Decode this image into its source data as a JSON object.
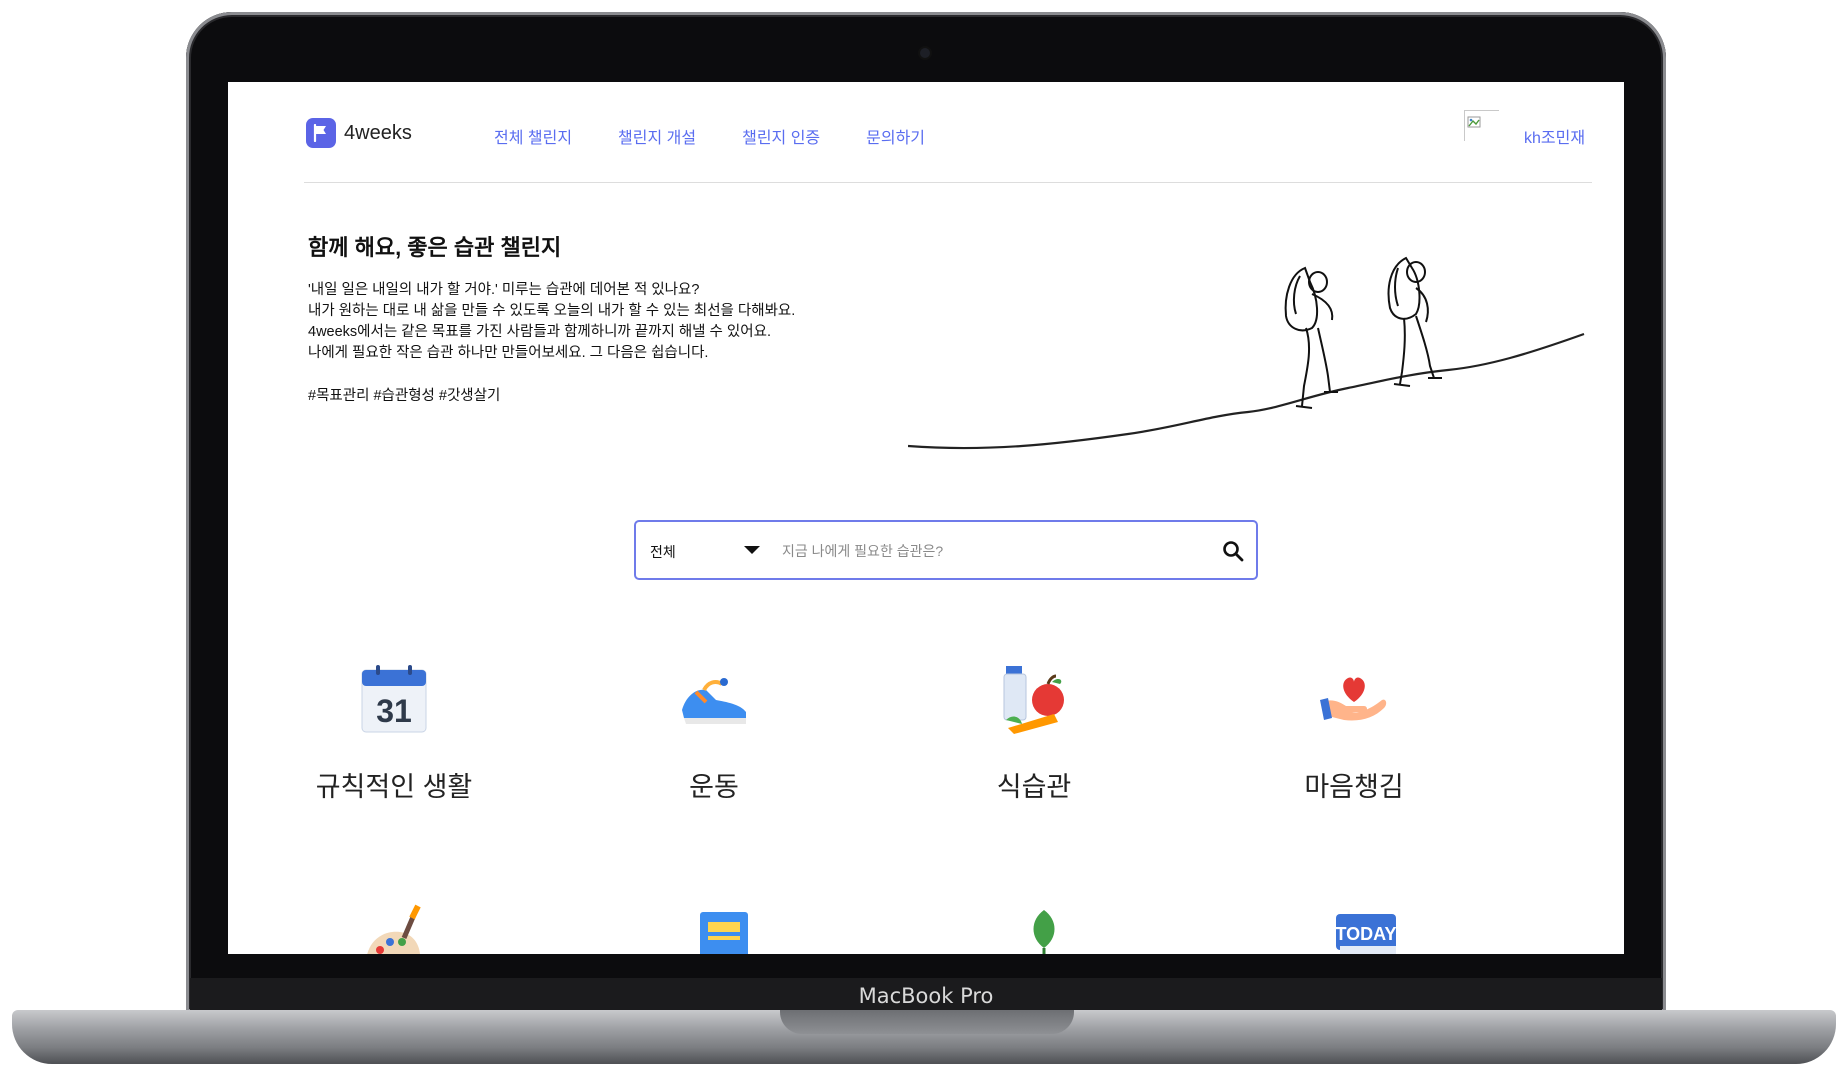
{
  "device": {
    "bezel_label": "MacBook Pro"
  },
  "header": {
    "logo_text": "4weeks",
    "nav": [
      {
        "label": "전체 챌린지"
      },
      {
        "label": "챌린지 개설"
      },
      {
        "label": "챌린지 인증"
      },
      {
        "label": "문의하기"
      }
    ],
    "user_name": "kh조민재"
  },
  "hero": {
    "title": "함께 해요, 좋은 습관 챌린지",
    "lines": [
      "'내일 일은 내일의 내가 할 거야.' 미루는 습관에 데어본 적 있나요?",
      "내가 원하는 대로 내 삶을 만들 수 있도록 오늘의 내가 할 수 있는 최선을 다해봐요.",
      "4weeks에서는 같은 목표를 가진 사람들과 함께하니까 끝까지 해낼 수 있어요.",
      "나에게 필요한 작은 습관 하나만 만들어보세요. 그 다음은 쉽습니다."
    ],
    "tags": "#목표관리 #습관형성 #갓생살기"
  },
  "search": {
    "category": "전체",
    "placeholder": "지금 나에게 필요한 습관은?",
    "value": ""
  },
  "categories": [
    {
      "label": "규칙적인 생활",
      "icon": "calendar-icon",
      "calendar_day": "31"
    },
    {
      "label": "운동",
      "icon": "sneaker-icon"
    },
    {
      "label": "식습관",
      "icon": "food-icon"
    },
    {
      "label": "마음챙김",
      "icon": "heart-hand-icon"
    }
  ],
  "categories_partial": [
    {
      "icon": "palette-icon"
    },
    {
      "icon": "book-icon"
    },
    {
      "icon": "leaf-icon"
    },
    {
      "icon": "today-icon",
      "text": "TODAY"
    }
  ],
  "colors": {
    "accent": "#5a6df0",
    "logo": "#5b64e6",
    "search_border": "#6f7bea"
  }
}
